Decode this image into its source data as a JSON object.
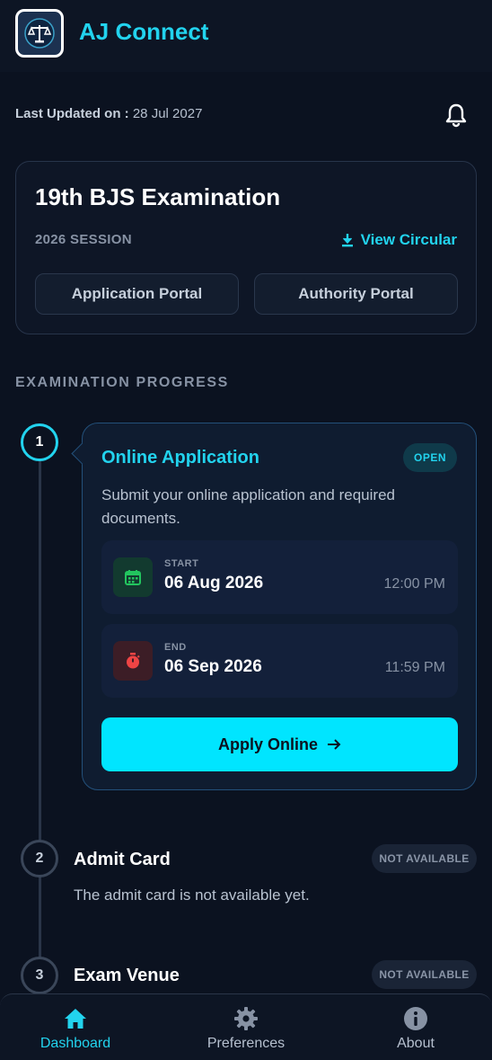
{
  "header": {
    "title": "AJ Connect",
    "logo_icon": "scales-of-justice-icon"
  },
  "status": {
    "updated_label": "Last Updated on :",
    "updated_date": "28 Jul 2027",
    "bell_icon": "bell-icon"
  },
  "exam": {
    "title": "19th BJS Examination",
    "session": "2026 SESSION",
    "view_circular": "View Circular",
    "application_portal": "Application Portal",
    "authority_portal": "Authority Portal"
  },
  "progress": {
    "heading": "EXAMINATION PROGRESS",
    "steps": [
      {
        "number": "1",
        "title": "Online Application",
        "badge": "OPEN",
        "description": "Submit your online application and required documents.",
        "start_label": "START",
        "start_date": "06 Aug 2026",
        "start_time": "12:00 PM",
        "end_label": "END",
        "end_date": "06 Sep 2026",
        "end_time": "11:59 PM",
        "action": "Apply Online"
      },
      {
        "number": "2",
        "title": "Admit Card",
        "badge": "NOT AVAILABLE",
        "description": "The admit card is not available yet."
      },
      {
        "number": "3",
        "title": "Exam Venue",
        "badge": "NOT AVAILABLE"
      }
    ]
  },
  "nav": {
    "items": [
      {
        "label": "Dashboard",
        "icon": "home-icon",
        "active": true
      },
      {
        "label": "Preferences",
        "icon": "gear-icon",
        "active": false
      },
      {
        "label": "About",
        "icon": "info-icon",
        "active": false
      }
    ]
  },
  "colors": {
    "accent": "#22d3ee",
    "button": "#00e5ff",
    "background": "#0b1220",
    "start_icon": "#22c55e",
    "end_icon": "#ef4444"
  }
}
